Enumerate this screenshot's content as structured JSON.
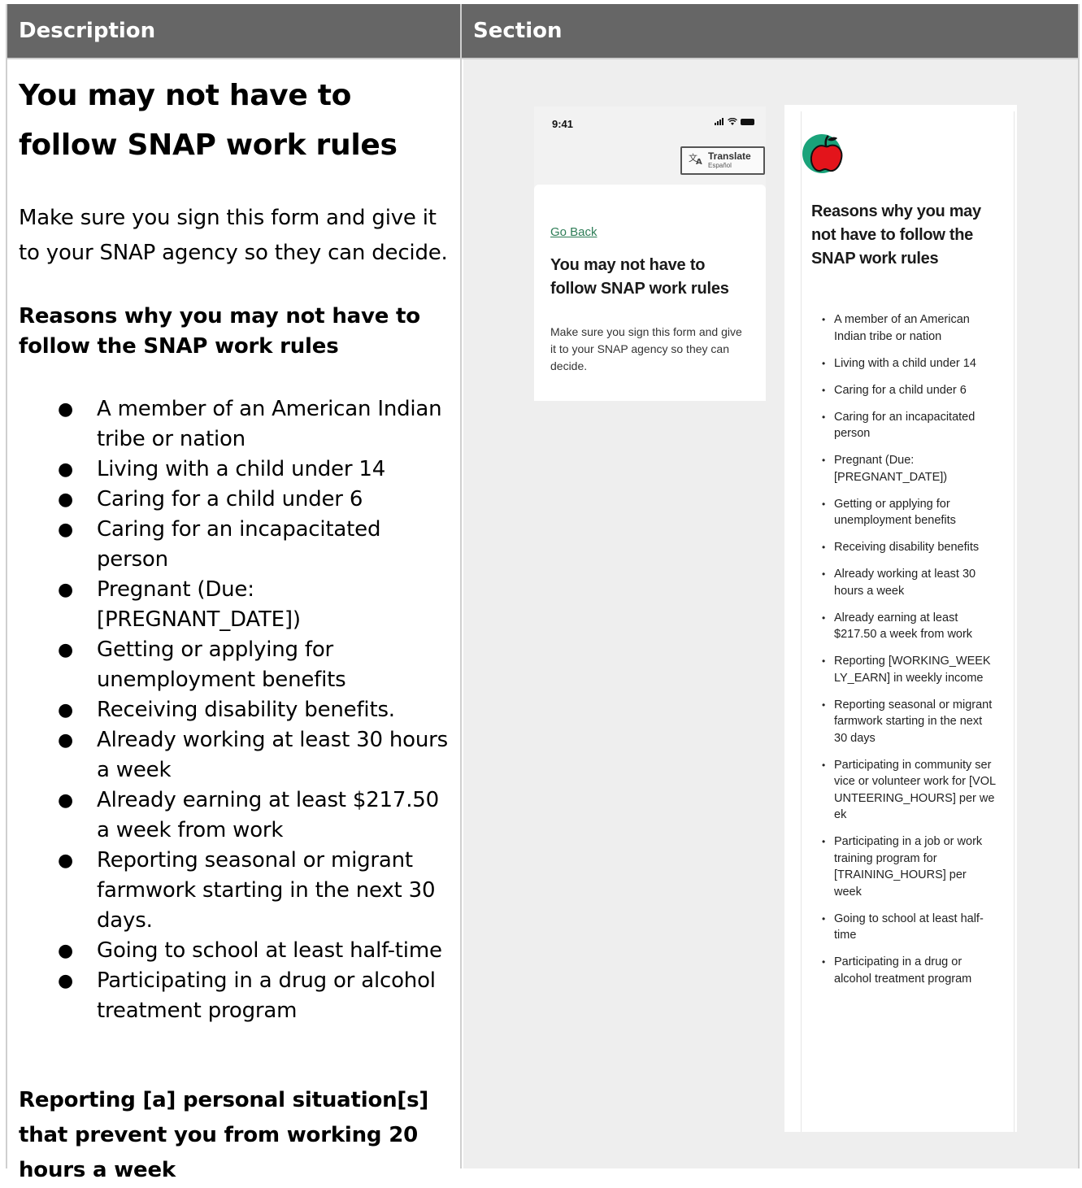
{
  "table": {
    "headers": [
      "Description",
      "Section"
    ]
  },
  "description": {
    "title": "You may not have to follow SNAP work rules",
    "intro": "Make sure you sign this form and give it to your SNAP agency so they can decide.",
    "reasons_heading": "Reasons why you may not have to follow the SNAP work rules",
    "reasons": [
      "A member of an American Indian tribe or nation",
      "Living with a child under 14",
      "Caring for a child under 6",
      "Caring for an incapacitated person",
      "Pregnant (Due: [PREGNANT_DATE])",
      "Getting or applying for unemployment benefits",
      "Receiving disability benefits.",
      "Already working at least 30 hours a week",
      "Already earning at least $217.50 a week from work",
      "Reporting seasonal or migrant farmwork starting in the next 30 days.",
      "Going to school at least half-time",
      "Participating in a drug or alcohol treatment program"
    ],
    "reporting_heading": "Reporting [a] personal situation[s] that prevent you from working 20 hours a week"
  },
  "screen1": {
    "time": "9:41",
    "translate_label": "Translate",
    "translate_sub": "Español",
    "go_back": "Go Back",
    "title": "You may not have to follow SNAP work rules",
    "body": "Make sure you sign this form and give it to your SNAP agency so they can decide."
  },
  "screen2": {
    "title": "Reasons why you may not have to follow the SNAP work rules",
    "items": [
      "A member of an American Indian tribe or nation",
      "Living with a child under 14",
      "Caring for a child under 6",
      "Caring for an incapacitated person",
      "Pregnant (Due: [PREGNANT_DATE])",
      "Getting or applying for unemployment benefits",
      "Receiving disability benefits",
      "Already working at least 30 hours a week",
      "Already earning at least $217.50 a week from work",
      "Reporting [WORKING_WEEKLY_EARN] in weekly income",
      "Reporting seasonal or migrant farmwork starting in the next 30 days",
      "Participating in community service or volunteer work for [VOLUNTEERING_HOURS] per week",
      "Participating in a job or work training program for [TRAINING_HOURS] per week",
      "Going to school at least half-time",
      "Participating in a drug or alcohol treatment program"
    ]
  },
  "colors": {
    "header_bg": "#666666",
    "link_green": "#2e7d57",
    "apple_red": "#e3141b",
    "apple_teal": "#1aa37a"
  },
  "icons": [
    "translate-icon",
    "apple-icon",
    "signal-icon",
    "wifi-icon",
    "battery-icon"
  ]
}
